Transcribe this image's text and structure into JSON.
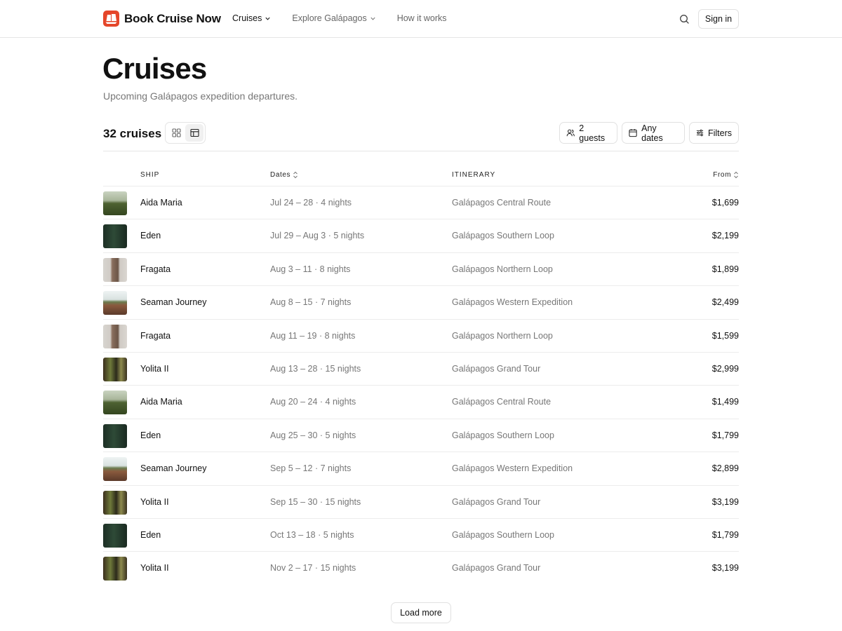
{
  "header": {
    "brand": "Book Cruise Now",
    "nav": [
      {
        "label": "Cruises",
        "dropdown": true,
        "active": true
      },
      {
        "label": "Explore Galápagos",
        "dropdown": true,
        "active": false
      },
      {
        "label": "How it works",
        "dropdown": false,
        "active": false
      }
    ],
    "search_icon": "search-icon",
    "signin_label": "Sign in"
  },
  "page": {
    "title": "Cruises",
    "subtitle": "Upcoming Galápagos expedition departures."
  },
  "toolbar": {
    "count": "32 cruises",
    "view_modes": [
      "grid-view-icon",
      "table-view-icon"
    ],
    "active_view": "table",
    "guests_label": "2 guests",
    "dates_label": "Any dates",
    "filters_label": "Filters"
  },
  "table": {
    "headers": {
      "ship": "SHIP",
      "dates": "Dates",
      "itinerary": "ITINERARY",
      "from": "From"
    },
    "rows": [
      {
        "ship": "Aida Maria",
        "dates": "Jul 24 – 28 · 4 nights",
        "itinerary": "Galápagos Central Route",
        "price": "$1,699",
        "thumb": "green"
      },
      {
        "ship": "Eden",
        "dates": "Jul 29 – Aug 3 · 5 nights",
        "itinerary": "Galápagos Southern Loop",
        "price": "$2,199",
        "thumb": "forest"
      },
      {
        "ship": "Fragata",
        "dates": "Aug 3 – 11 · 8 nights",
        "itinerary": "Galápagos Northern Loop",
        "price": "$1,899",
        "thumb": "tower"
      },
      {
        "ship": "Seaman Journey",
        "dates": "Aug 8 – 15 · 7 nights",
        "itinerary": "Galápagos Western Expedition",
        "price": "$2,499",
        "thumb": "rail"
      },
      {
        "ship": "Fragata",
        "dates": "Aug 11 – 19 · 8 nights",
        "itinerary": "Galápagos Northern Loop",
        "price": "$1,599",
        "thumb": "tower"
      },
      {
        "ship": "Yolita II",
        "dates": "Aug 13 – 28 · 15 nights",
        "itinerary": "Galápagos Grand Tour",
        "price": "$2,999",
        "thumb": "jungle"
      },
      {
        "ship": "Aida Maria",
        "dates": "Aug 20 – 24 · 4 nights",
        "itinerary": "Galápagos Central Route",
        "price": "$1,499",
        "thumb": "green"
      },
      {
        "ship": "Eden",
        "dates": "Aug 25 – 30 · 5 nights",
        "itinerary": "Galápagos Southern Loop",
        "price": "$1,799",
        "thumb": "forest"
      },
      {
        "ship": "Seaman Journey",
        "dates": "Sep 5 – 12 · 7 nights",
        "itinerary": "Galápagos Western Expedition",
        "price": "$2,899",
        "thumb": "rail"
      },
      {
        "ship": "Yolita II",
        "dates": "Sep 15 – 30 · 15 nights",
        "itinerary": "Galápagos Grand Tour",
        "price": "$3,199",
        "thumb": "jungle"
      },
      {
        "ship": "Eden",
        "dates": "Oct 13 – 18 · 5 nights",
        "itinerary": "Galápagos Southern Loop",
        "price": "$1,799",
        "thumb": "forest"
      },
      {
        "ship": "Yolita II",
        "dates": "Nov 2 – 17 · 15 nights",
        "itinerary": "Galápagos Grand Tour",
        "price": "$3,199",
        "thumb": "jungle"
      }
    ]
  },
  "load_more_label": "Load more",
  "colors": {
    "brand": "#e5462a",
    "text": "#111111",
    "muted": "#777777",
    "border": "#e5e5e5"
  }
}
